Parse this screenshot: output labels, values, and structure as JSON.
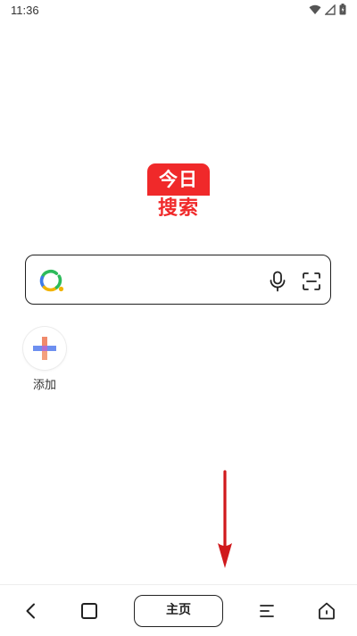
{
  "status_bar": {
    "time": "11:36",
    "icons": [
      "wifi-icon",
      "signal-icon",
      "battery-icon"
    ]
  },
  "logo": {
    "line1": "今日",
    "line2": "搜索",
    "brand_color": "#f0292a"
  },
  "search": {
    "value": "",
    "placeholder": "",
    "logo_icon": "search-logo-icon",
    "voice_icon": "microphone-icon",
    "scan_icon": "scan-icon"
  },
  "shortcuts": {
    "add_label": "添加",
    "add_icon": "plus-icon"
  },
  "bottom_nav": {
    "back_icon": "back-arrow-icon",
    "tabs_icon": "tabs-square-icon",
    "home_label": "主页",
    "menu_icon": "menu-icon",
    "home_icon": "home-icon"
  },
  "annotation": {
    "arrow_color": "#d0191c",
    "arrow_direction": "down"
  }
}
